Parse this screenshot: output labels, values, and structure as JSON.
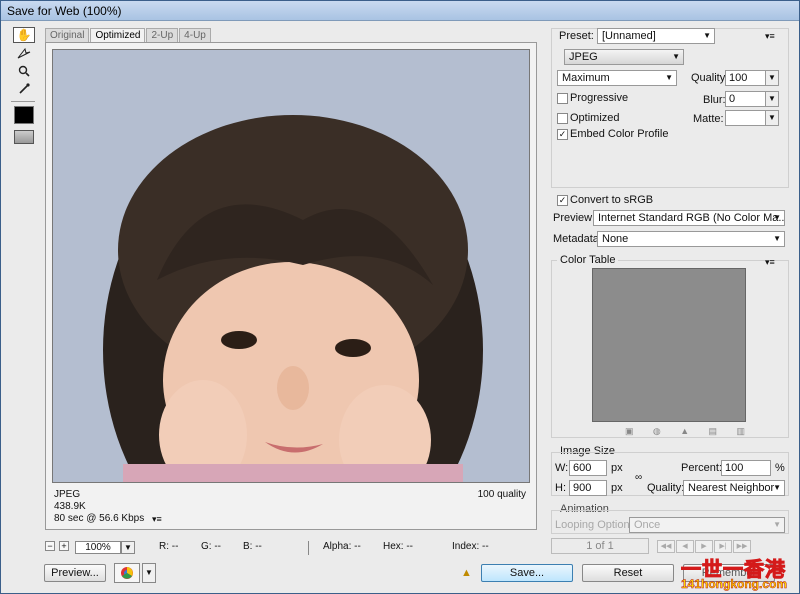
{
  "window": {
    "title": "Save for Web (100%)"
  },
  "tools": [
    "hand-tool",
    "slice-select-tool",
    "zoom-tool",
    "eyedropper-tool"
  ],
  "tabs": [
    {
      "label": "Original",
      "active": false
    },
    {
      "label": "Optimized",
      "active": true
    },
    {
      "label": "2-Up",
      "active": false
    },
    {
      "label": "4-Up",
      "active": false
    }
  ],
  "canvas": {
    "image_alt": "portrait photo",
    "format": "JPEG",
    "size": "438.9K",
    "speed": "80 sec @ 56.6 Kbps",
    "speed_menu": "▾≡",
    "quality": "100 quality"
  },
  "status": {
    "zoom_minus": "−",
    "zoom_plus": "+",
    "zoom": "100%",
    "r": "R: --",
    "g": "G: --",
    "b": "B: --",
    "alpha": "Alpha: --",
    "hex": "Hex: --",
    "index": "Index: --"
  },
  "buttons": {
    "preview": "Preview...",
    "save": "Save...",
    "reset": "Reset",
    "remember": "Remember"
  },
  "settings": {
    "preset_label": "Preset:",
    "preset_value": "[Unnamed]",
    "format": "JPEG",
    "compression": "Maximum",
    "quality_label": "Quality:",
    "quality_value": "100",
    "blur_label": "Blur:",
    "blur_value": "0",
    "matte_label": "Matte:",
    "matte_value": "",
    "progressive": {
      "label": "Progressive",
      "checked": false
    },
    "optimized": {
      "label": "Optimized",
      "checked": false
    },
    "embed_profile": {
      "label": "Embed Color Profile",
      "checked": true
    },
    "convert_srgb": {
      "label": "Convert to sRGB",
      "checked": true
    },
    "preview_label": "Preview:",
    "preview_value": "Internet Standard RGB (No Color Ma...",
    "metadata_label": "Metadata:",
    "metadata_value": "None"
  },
  "color_table": {
    "title": "Color Table"
  },
  "image_size": {
    "title": "Image Size",
    "w_label": "W:",
    "w_value": "600",
    "h_label": "H:",
    "h_value": "900",
    "unit": "px",
    "percent_label": "Percent:",
    "percent_value": "100",
    "percent_unit": "%",
    "quality_label": "Quality:",
    "quality_value": "Nearest Neighbor"
  },
  "animation": {
    "title": "Animation",
    "looping_label": "Looping Options:",
    "looping_value": "Once",
    "frame": "1 of 1"
  },
  "watermark": {
    "line1": "一世一香港",
    "line2": "141hongkong.com"
  },
  "colors": {
    "save_accent": "#bee6fd",
    "table_fill": "#8c8c8c",
    "watermark_red": "#d41a1a"
  }
}
